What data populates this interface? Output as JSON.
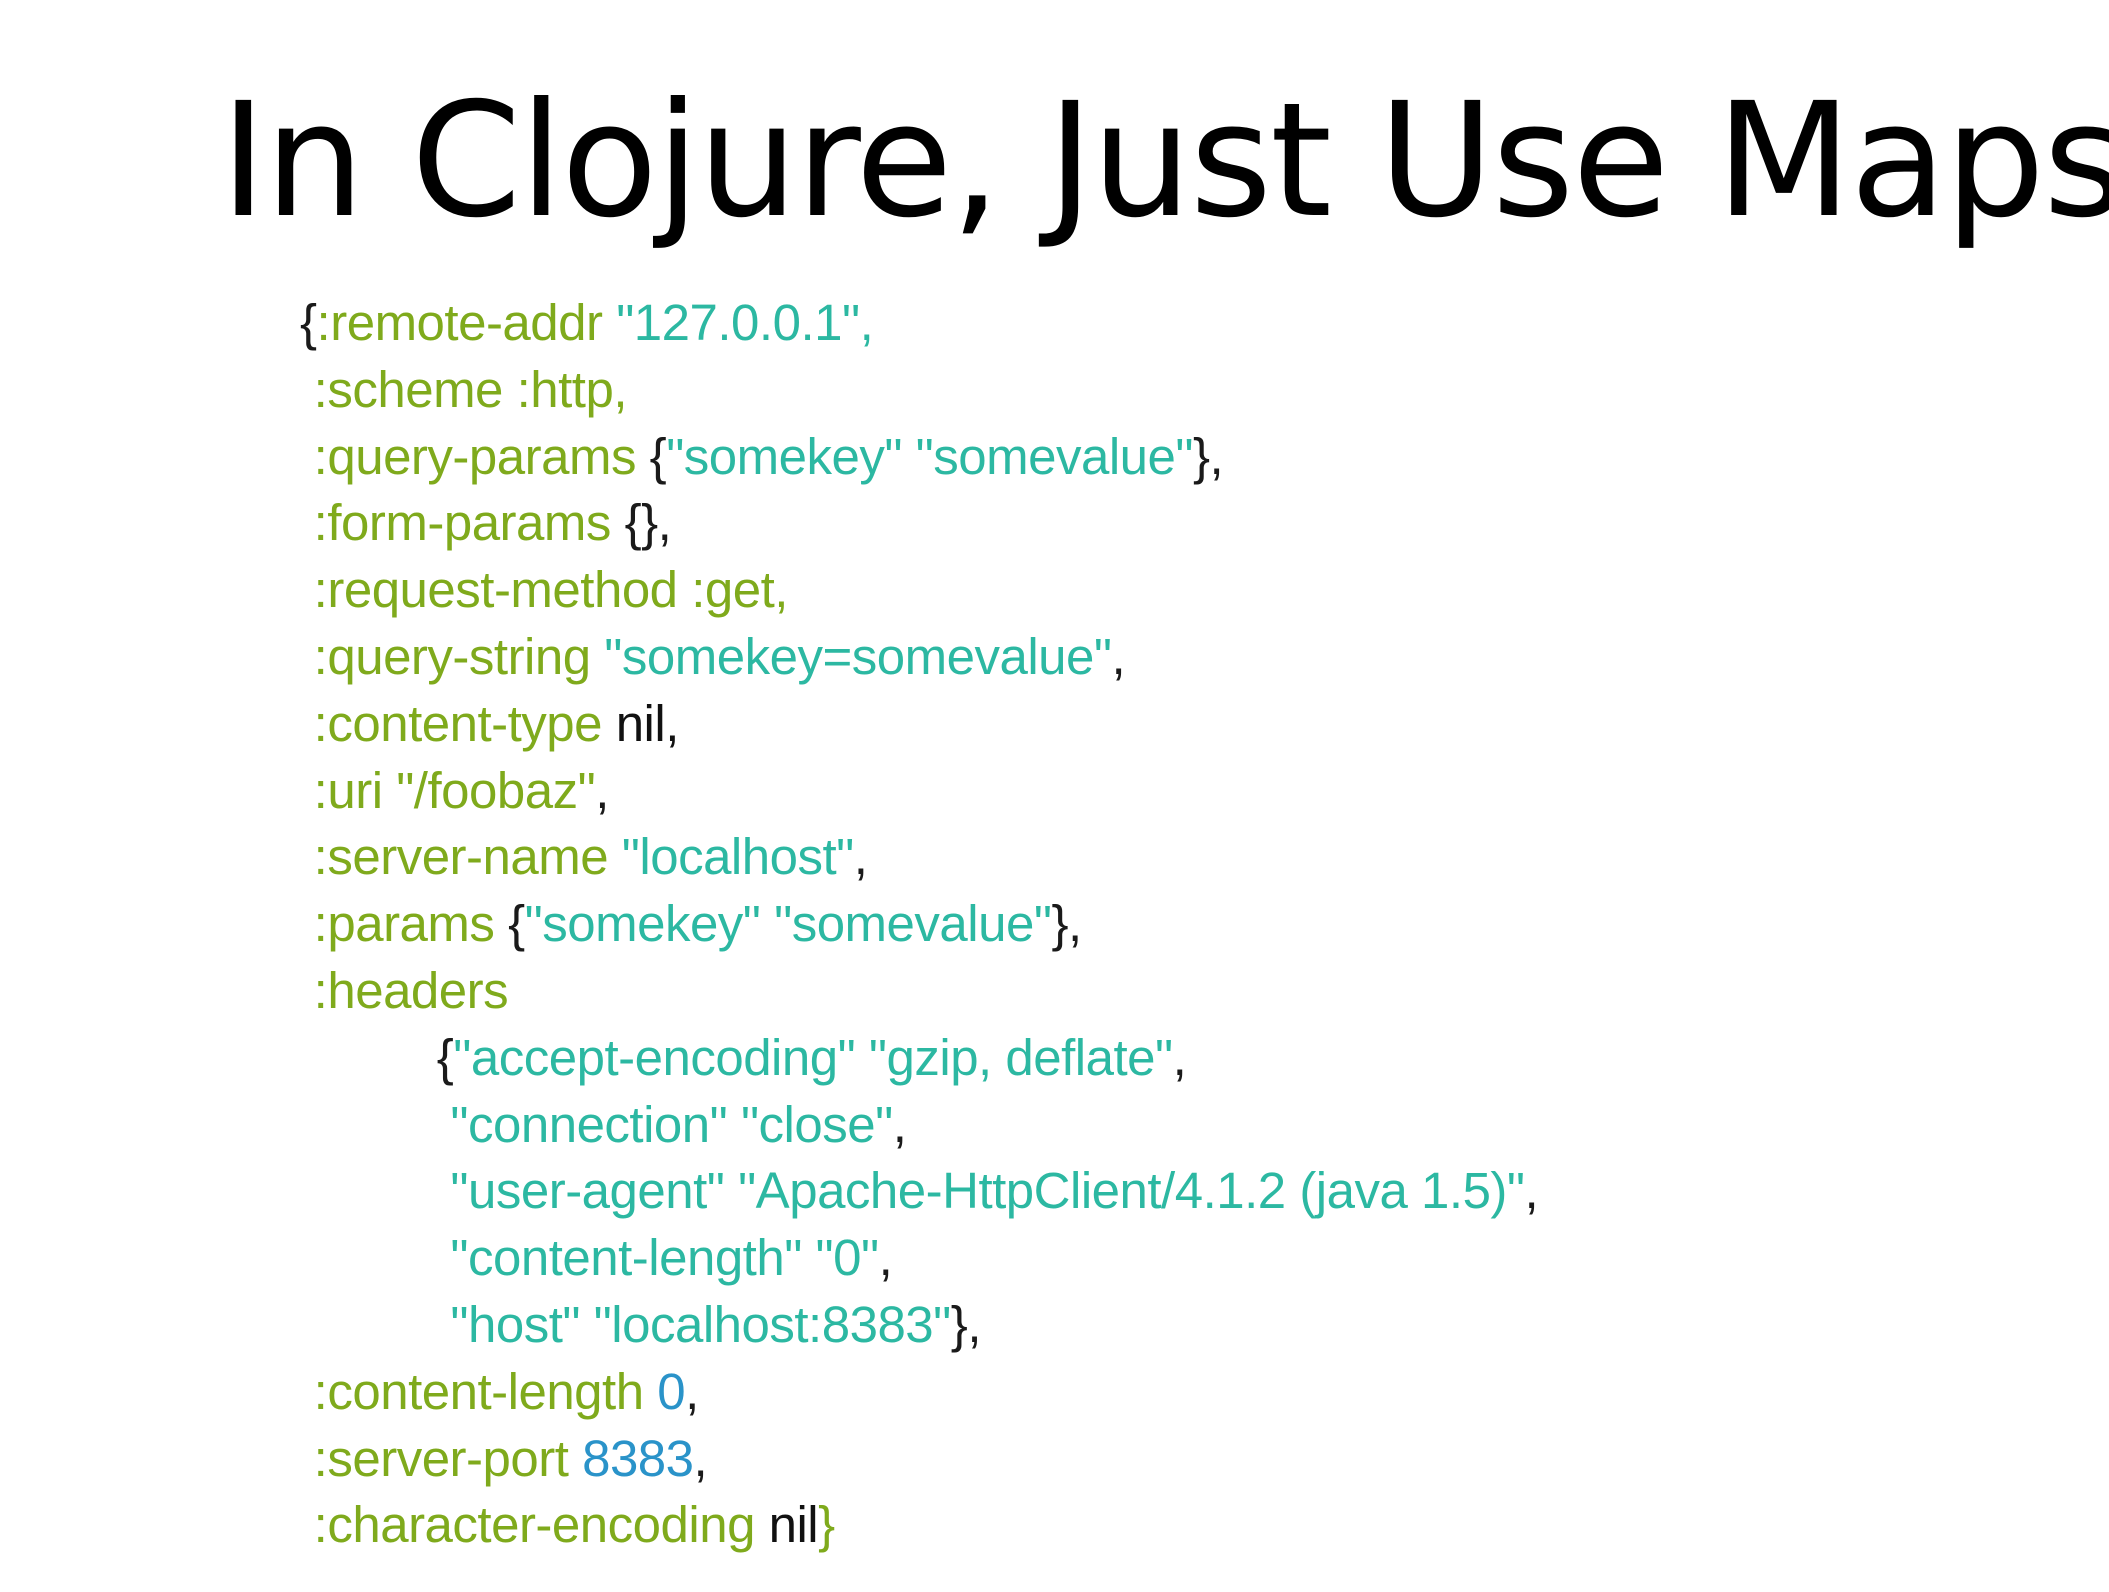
{
  "title": "In Clojure, Just Use Maps",
  "colors": {
    "keyword": "#7faa1c",
    "string": "#2cb8a2",
    "number": "#2a93c9",
    "punct": "#1a1a1a"
  },
  "code_lines": [
    {
      "indent": "",
      "tokens": [
        {
          "t": "punct",
          "v": "{"
        },
        {
          "t": "keyword",
          "v": ":remote-addr"
        },
        {
          "t": "space",
          "v": " "
        },
        {
          "t": "string",
          "v": "\"127.0.0.1\""
        },
        {
          "t": "string",
          "v": ","
        }
      ]
    },
    {
      "indent": " ",
      "tokens": [
        {
          "t": "keyword",
          "v": ":scheme"
        },
        {
          "t": "space",
          "v": " "
        },
        {
          "t": "keyword",
          "v": ":http,"
        }
      ]
    },
    {
      "indent": " ",
      "tokens": [
        {
          "t": "keyword",
          "v": ":query-params"
        },
        {
          "t": "space",
          "v": " "
        },
        {
          "t": "punct",
          "v": "{"
        },
        {
          "t": "string",
          "v": "\"somekey\""
        },
        {
          "t": "space",
          "v": " "
        },
        {
          "t": "string",
          "v": "\"somevalue\""
        },
        {
          "t": "punct",
          "v": "},"
        }
      ]
    },
    {
      "indent": " ",
      "tokens": [
        {
          "t": "keyword",
          "v": ":form-params"
        },
        {
          "t": "space",
          "v": " "
        },
        {
          "t": "punct",
          "v": "{},"
        }
      ]
    },
    {
      "indent": " ",
      "tokens": [
        {
          "t": "keyword",
          "v": ":request-method"
        },
        {
          "t": "space",
          "v": " "
        },
        {
          "t": "keyword",
          "v": ":get,"
        }
      ]
    },
    {
      "indent": " ",
      "tokens": [
        {
          "t": "keyword",
          "v": ":query-string"
        },
        {
          "t": "space",
          "v": " "
        },
        {
          "t": "string",
          "v": "\"somekey=somevalue\""
        },
        {
          "t": "punct",
          "v": ","
        }
      ]
    },
    {
      "indent": " ",
      "tokens": [
        {
          "t": "keyword",
          "v": ":content-type"
        },
        {
          "t": "space",
          "v": " "
        },
        {
          "t": "nil",
          "v": "nil,"
        }
      ]
    },
    {
      "indent": " ",
      "tokens": [
        {
          "t": "keyword",
          "v": ":uri"
        },
        {
          "t": "space",
          "v": " "
        },
        {
          "t": "keyword",
          "v": "\"/foobaz\""
        },
        {
          "t": "punct",
          "v": ","
        }
      ]
    },
    {
      "indent": " ",
      "tokens": [
        {
          "t": "keyword",
          "v": ":server-name"
        },
        {
          "t": "space",
          "v": " "
        },
        {
          "t": "string",
          "v": "\"localhost\""
        },
        {
          "t": "punct",
          "v": ","
        }
      ]
    },
    {
      "indent": " ",
      "tokens": [
        {
          "t": "keyword",
          "v": ":params"
        },
        {
          "t": "space",
          "v": " "
        },
        {
          "t": "punct",
          "v": "{"
        },
        {
          "t": "string",
          "v": "\"somekey\""
        },
        {
          "t": "space",
          "v": " "
        },
        {
          "t": "string",
          "v": "\"somevalue\""
        },
        {
          "t": "punct",
          "v": "},"
        }
      ]
    },
    {
      "indent": " ",
      "tokens": [
        {
          "t": "keyword",
          "v": ":headers"
        }
      ]
    },
    {
      "indent": "          ",
      "tokens": [
        {
          "t": "punct",
          "v": "{"
        },
        {
          "t": "string",
          "v": "\"accept-encoding\""
        },
        {
          "t": "space",
          "v": " "
        },
        {
          "t": "string",
          "v": "\"gzip, deflate\""
        },
        {
          "t": "punct",
          "v": ","
        }
      ]
    },
    {
      "indent": "           ",
      "tokens": [
        {
          "t": "string",
          "v": "\"connection\""
        },
        {
          "t": "space",
          "v": " "
        },
        {
          "t": "string",
          "v": "\"close\""
        },
        {
          "t": "punct",
          "v": ","
        }
      ]
    },
    {
      "indent": "           ",
      "tokens": [
        {
          "t": "string",
          "v": "\"user-agent\""
        },
        {
          "t": "space",
          "v": " "
        },
        {
          "t": "string",
          "v": "\"Apache-HttpClient/4.1.2 (java 1.5)\""
        },
        {
          "t": "punct",
          "v": ","
        }
      ]
    },
    {
      "indent": "           ",
      "tokens": [
        {
          "t": "string",
          "v": "\"content-length\""
        },
        {
          "t": "space",
          "v": " "
        },
        {
          "t": "string",
          "v": "\"0\""
        },
        {
          "t": "punct",
          "v": ","
        }
      ]
    },
    {
      "indent": "           ",
      "tokens": [
        {
          "t": "string",
          "v": "\"host\""
        },
        {
          "t": "space",
          "v": " "
        },
        {
          "t": "string",
          "v": "\"localhost:8383\""
        },
        {
          "t": "punct",
          "v": "},"
        }
      ]
    },
    {
      "indent": " ",
      "tokens": [
        {
          "t": "keyword",
          "v": ":content-length"
        },
        {
          "t": "space",
          "v": " "
        },
        {
          "t": "number",
          "v": "0"
        },
        {
          "t": "punct",
          "v": ","
        }
      ]
    },
    {
      "indent": " ",
      "tokens": [
        {
          "t": "keyword",
          "v": ":server-port"
        },
        {
          "t": "space",
          "v": " "
        },
        {
          "t": "number",
          "v": "8383"
        },
        {
          "t": "punct",
          "v": ","
        }
      ]
    },
    {
      "indent": " ",
      "tokens": [
        {
          "t": "keyword",
          "v": ":character-encoding"
        },
        {
          "t": "space",
          "v": " "
        },
        {
          "t": "nil",
          "v": "nil"
        },
        {
          "t": "brace-end",
          "v": "}"
        }
      ]
    }
  ]
}
